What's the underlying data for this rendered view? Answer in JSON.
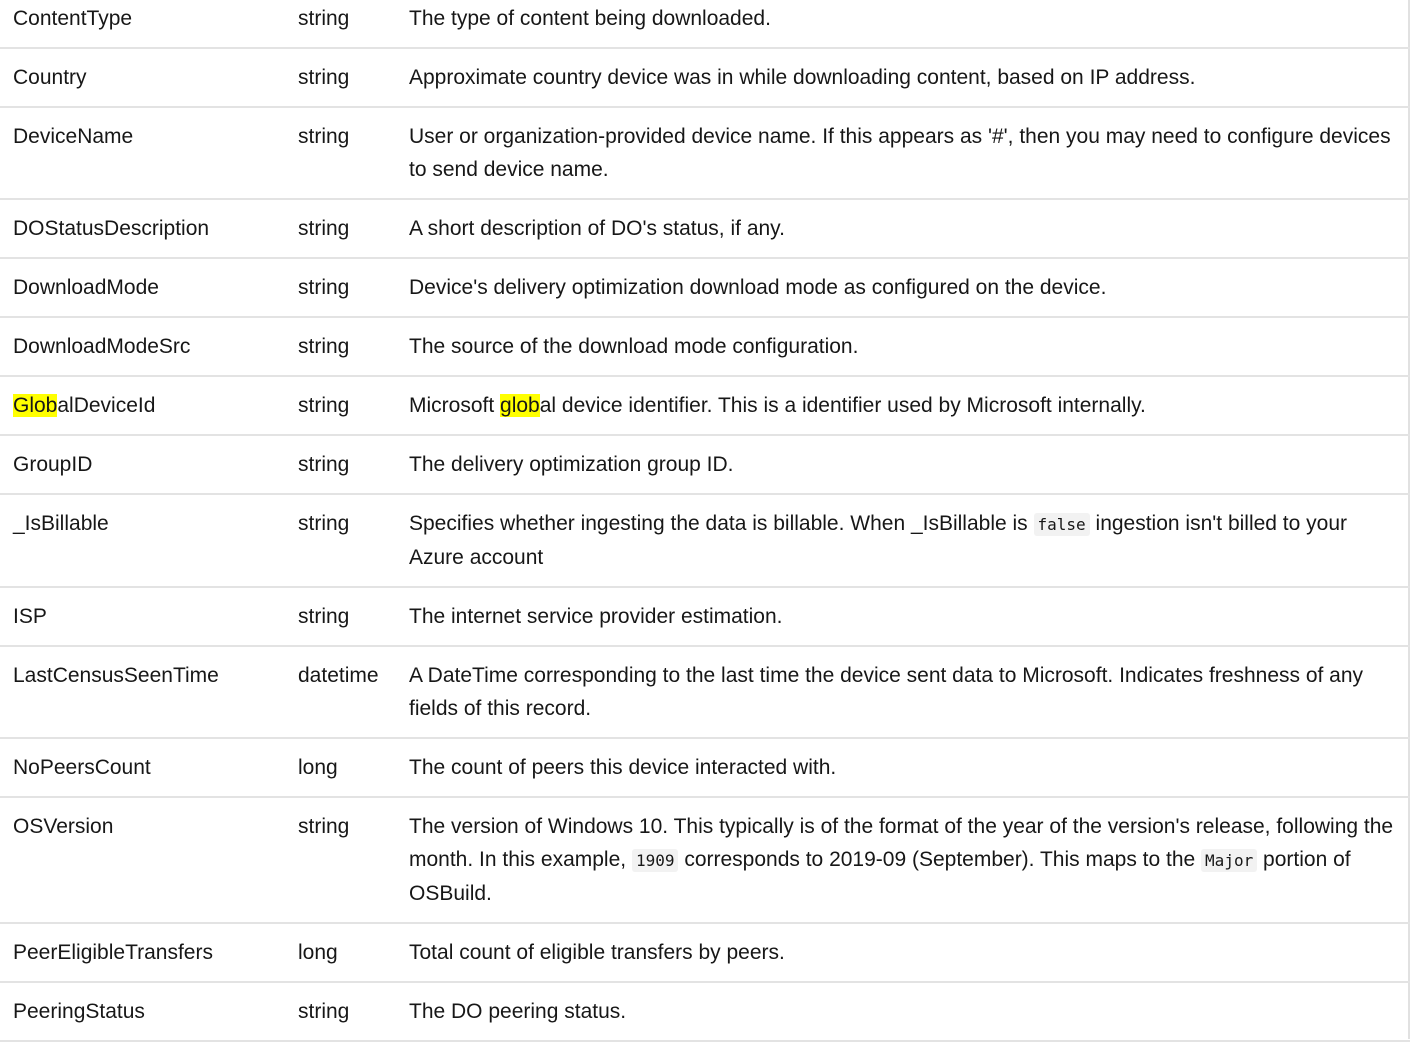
{
  "rows": [
    {
      "name": "ContentType",
      "type": "string",
      "desc": [
        {
          "t": "The type of content being downloaded."
        }
      ]
    },
    {
      "name": "Country",
      "type": "string",
      "desc": [
        {
          "t": "Approximate country device was in while downloading content, based on IP address."
        }
      ]
    },
    {
      "name": "DeviceName",
      "type": "string",
      "desc": [
        {
          "t": "User or organization-provided device name. If this appears as '#', then you may need to configure devices to send device name."
        }
      ]
    },
    {
      "name": "DOStatusDescription",
      "type": "string",
      "desc": [
        {
          "t": "A short description of DO's status, if any."
        }
      ]
    },
    {
      "name": "DownloadMode",
      "type": "string",
      "desc": [
        {
          "t": "Device's delivery optimization download mode as configured on the device."
        }
      ]
    },
    {
      "name": "DownloadModeSrc",
      "type": "string",
      "desc": [
        {
          "t": "The source of the download mode configuration."
        }
      ]
    },
    {
      "name_segments": [
        {
          "t": "Glob",
          "hl": true
        },
        {
          "t": "alDeviceId"
        }
      ],
      "type": "string",
      "desc": [
        {
          "t": "Microsoft "
        },
        {
          "t": "glob",
          "hl": true
        },
        {
          "t": "al device identifier. This is a identifier used by Microsoft internally."
        }
      ]
    },
    {
      "name": "GroupID",
      "type": "string",
      "desc": [
        {
          "t": "The delivery optimization group ID."
        }
      ]
    },
    {
      "name": "_IsBillable",
      "type": "string",
      "desc": [
        {
          "t": "Specifies whether ingesting the data is billable. When _IsBillable is "
        },
        {
          "t": "false",
          "code": true
        },
        {
          "t": " ingestion isn't billed to your Azure account"
        }
      ]
    },
    {
      "name": "ISP",
      "type": "string",
      "desc": [
        {
          "t": "The internet service provider estimation."
        }
      ]
    },
    {
      "name": "LastCensusSeenTime",
      "type": "datetime",
      "desc": [
        {
          "t": "A DateTime corresponding to the last time the device sent data to Microsoft. Indicates freshness of any fields of this record."
        }
      ]
    },
    {
      "name": "NoPeersCount",
      "type": "long",
      "desc": [
        {
          "t": "The count of peers this device interacted with."
        }
      ]
    },
    {
      "name": "OSVersion",
      "type": "string",
      "desc": [
        {
          "t": "The version of Windows 10. This typically is of the format of the year of the version's release, following the month. In this example, "
        },
        {
          "t": "1909",
          "code": true
        },
        {
          "t": " corresponds to 2019-09 (September). This maps to the "
        },
        {
          "t": "Major",
          "code": true
        },
        {
          "t": " portion of OSBuild."
        }
      ]
    },
    {
      "name": "PeerEligibleTransfers",
      "type": "long",
      "desc": [
        {
          "t": "Total count of eligible transfers by peers."
        }
      ]
    },
    {
      "name": "PeeringStatus",
      "type": "string",
      "desc": [
        {
          "t": "The DO peering status."
        }
      ]
    }
  ]
}
